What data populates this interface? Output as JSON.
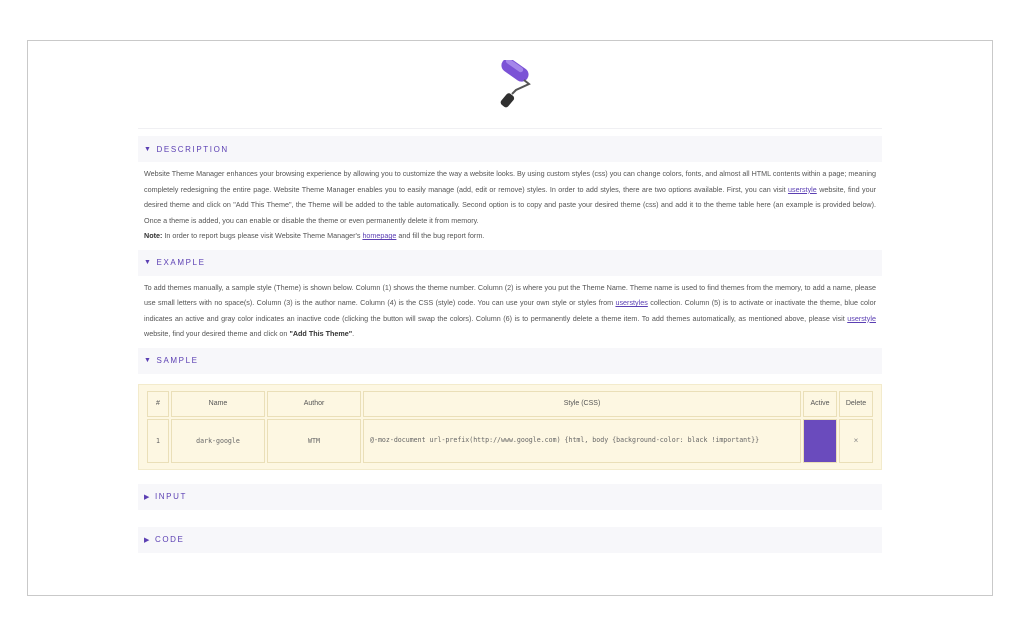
{
  "logo": {
    "icon": "paint-roller-icon",
    "color": "#7b52d6"
  },
  "accent_color": "#5b3fb3",
  "sections": {
    "description": {
      "label": "DESCRIPTION",
      "expanded": true,
      "text_1": "Website Theme Manager enhances your browsing experience by allowing you to customize the way a website looks. By using custom styles (css) you can change colors, fonts, and almost all HTML contents within a page; meaning completely redesigning the entire page. Website Theme Manager enables you to easily manage (add, edit or remove) styles. In order to add styles, there are two options available. First, you can visit ",
      "link_1": "userstyle",
      "text_2": " website, find your desired theme and click on \"Add This Theme\", the Theme will be added to the table automatically. Second option is to copy and paste your desired theme (css) and add it to the theme table here (an example is provided below). Once a theme is added, you can enable or disable the theme or even permanently delete it from memory.",
      "note_label": "Note:",
      "text_3": " In order to report bugs please visit Website Theme Manager's ",
      "link_2": "homepage",
      "text_4": " and fill the bug report form."
    },
    "example": {
      "label": "EXAMPLE",
      "expanded": true,
      "text_1": "To add themes manually, a sample style (Theme) is shown below. Column (1) shows the theme number. Column (2) is where you put the Theme Name. Theme name is used to find themes from the memory, to add a name, please use small letters with no space(s). Column (3) is the author name. Column (4) is the CSS (style) code. You can use your own style or styles from ",
      "link_1": "userstyles",
      "text_2": " collection. Column (5) is to activate or inactivate the theme, blue color indicates an active and gray color indicates an inactive code (clicking the button will swap the colors). Column (6) is to permanently delete a theme item. To add themes automatically, as mentioned above, please visit ",
      "link_2": "userstyle",
      "text_3": " website, find your desired theme and click on ",
      "bold": "\"Add This Theme\"",
      "text_4": "."
    },
    "sample": {
      "label": "SAMPLE",
      "expanded": true,
      "table": {
        "headers": {
          "num": "#",
          "name": "Name",
          "author": "Author",
          "style": "Style (CSS)",
          "active": "Active",
          "delete": "Delete"
        },
        "row": {
          "num": "1",
          "name": "dark-google",
          "author": "WTM",
          "style": "@-moz-document url-prefix(http://www.google.com) {html, body {background-color: black !important}}",
          "active_color": "#6a4bbd",
          "delete": "×"
        }
      }
    },
    "input": {
      "label": "INPUT",
      "expanded": false
    },
    "code": {
      "label": "CODE",
      "expanded": false
    }
  }
}
